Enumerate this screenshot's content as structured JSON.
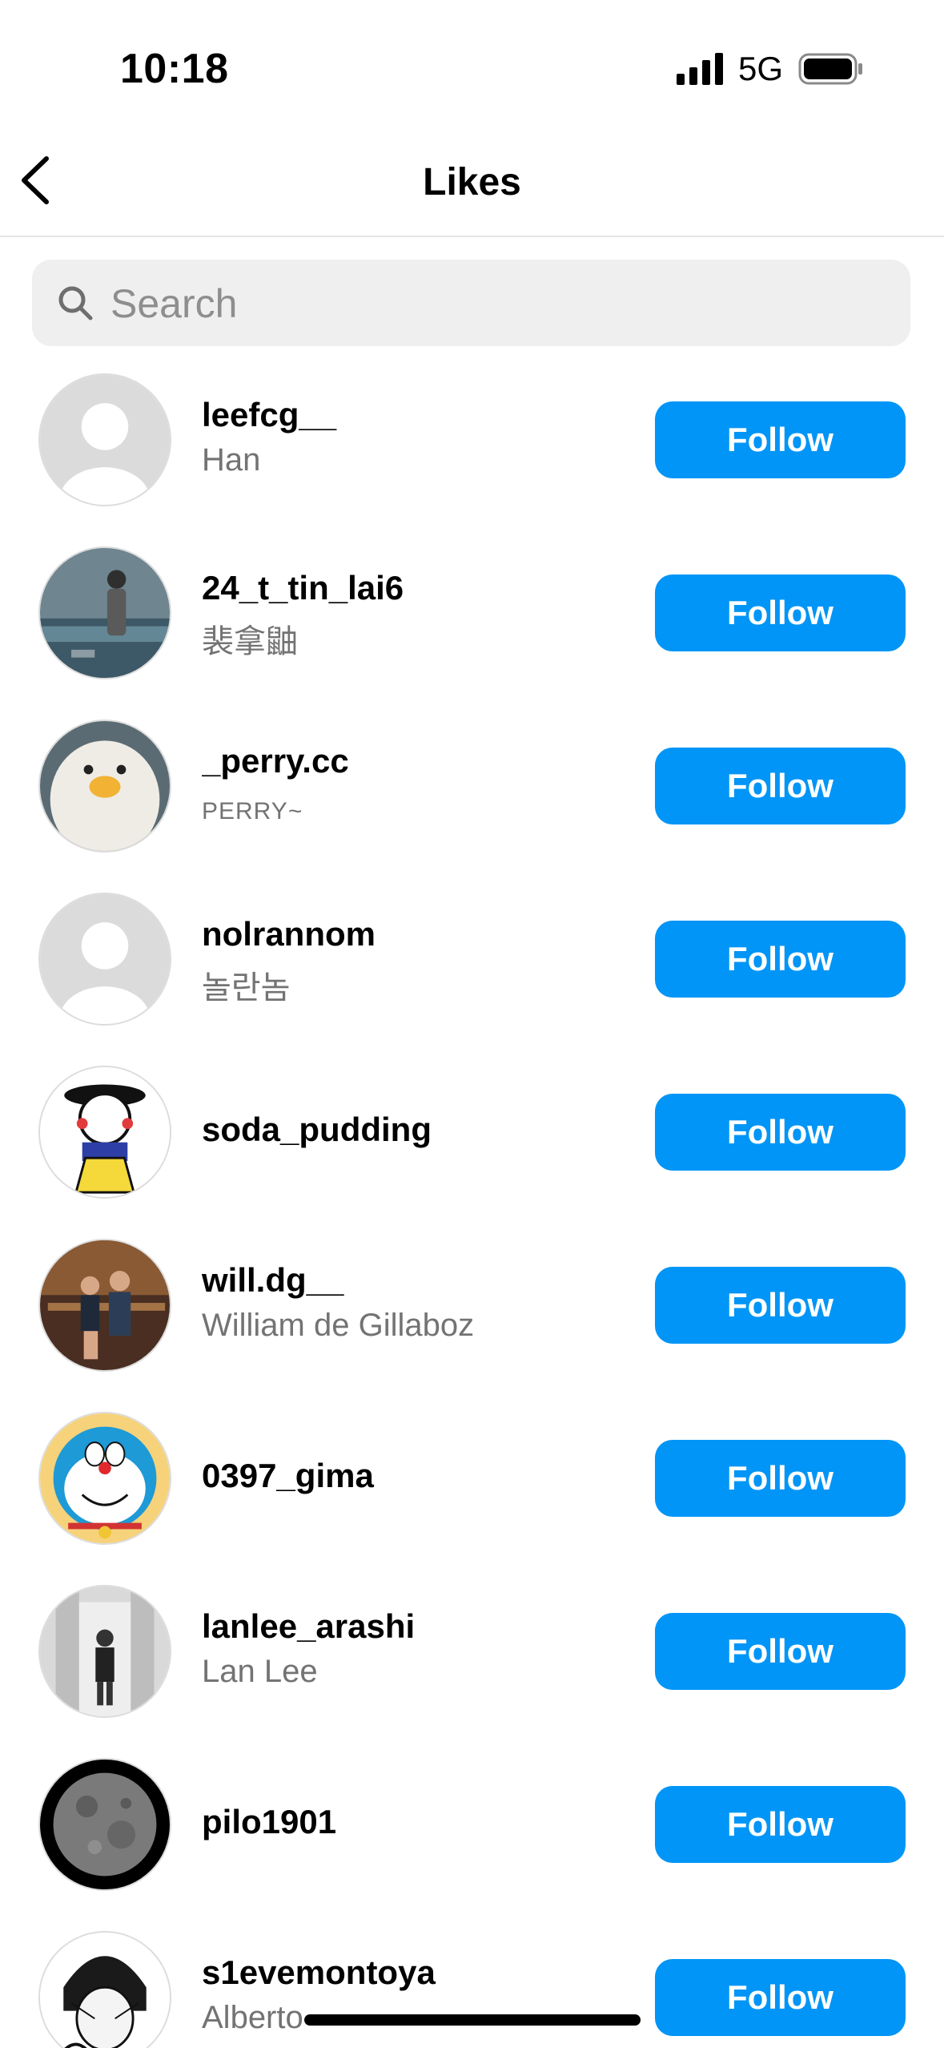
{
  "status_bar": {
    "time": "10:18",
    "network": "5G"
  },
  "header": {
    "title": "Likes",
    "back_icon": "chevron-left-icon"
  },
  "search": {
    "placeholder": "Search",
    "value": ""
  },
  "users": [
    {
      "username": "leefcg__",
      "name": "Han",
      "avatar": "default"
    },
    {
      "username": "24_t_tin_lai6",
      "name": "裴拿鼬",
      "avatar": "photo-person-water"
    },
    {
      "username": "_perry.cc",
      "name": "PERRY~",
      "avatar": "plush-duck"
    },
    {
      "username": "nolrannom",
      "name": "놀란놈",
      "avatar": "default"
    },
    {
      "username": "soda_pudding",
      "name": "",
      "avatar": "cartoon-character"
    },
    {
      "username": "will.dg__",
      "name": "William de Gillaboz",
      "avatar": "photo-couple"
    },
    {
      "username": "0397_gima",
      "name": "",
      "avatar": "doraemon"
    },
    {
      "username": "lanlee_arashi",
      "name": "Lan Lee",
      "avatar": "photo-hallway"
    },
    {
      "username": "pilo1901",
      "name": "",
      "avatar": "moon"
    },
    {
      "username": "s1evemontoya",
      "name": "Alberto",
      "avatar": "manga-drawing"
    }
  ],
  "follow_label": "Follow",
  "colors": {
    "follow_button": "#0095f6",
    "secondary_text": "#737373",
    "search_background": "#efefef"
  }
}
